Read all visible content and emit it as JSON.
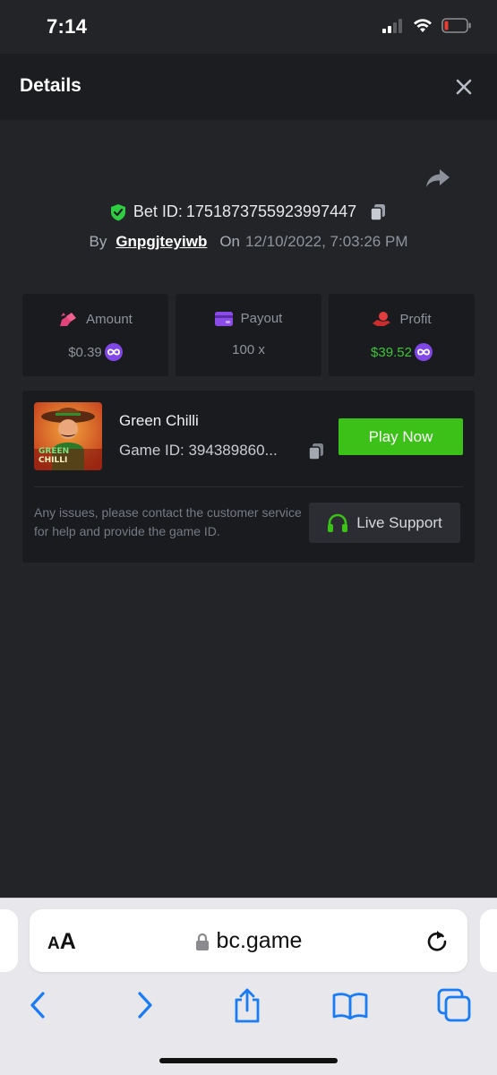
{
  "status_bar": {
    "time": "7:14"
  },
  "header": {
    "title": "Details"
  },
  "bet": {
    "id_label": "Bet ID:",
    "id_value": "1751873755923997447",
    "by_label": "By",
    "username": "Gnpgjteyiwb",
    "on_label": "On",
    "date": "12/10/2022, 7:03:26 PM"
  },
  "stats": {
    "amount": {
      "label": "Amount",
      "value": "$0.39"
    },
    "payout": {
      "label": "Payout",
      "value": "100 x"
    },
    "profit": {
      "label": "Profit",
      "value": "$39.52"
    }
  },
  "game": {
    "name": "Green Chilli",
    "id_text": "Game ID: 394389860...",
    "thumb_line1": "GREEN",
    "thumb_line2": "CHILLI",
    "play_label": "Play Now",
    "issue_text": "Any issues, please contact the customer service for help and provide the game ID.",
    "support_label": "Live Support"
  },
  "browser": {
    "aa_small": "A",
    "aa_large": "A",
    "url": "bc.game"
  },
  "colors": {
    "accent_green": "#3bc117",
    "profit_green": "#3ec33a",
    "coin_purple": "#8047e6",
    "safari_blue": "#1a7cf5"
  }
}
